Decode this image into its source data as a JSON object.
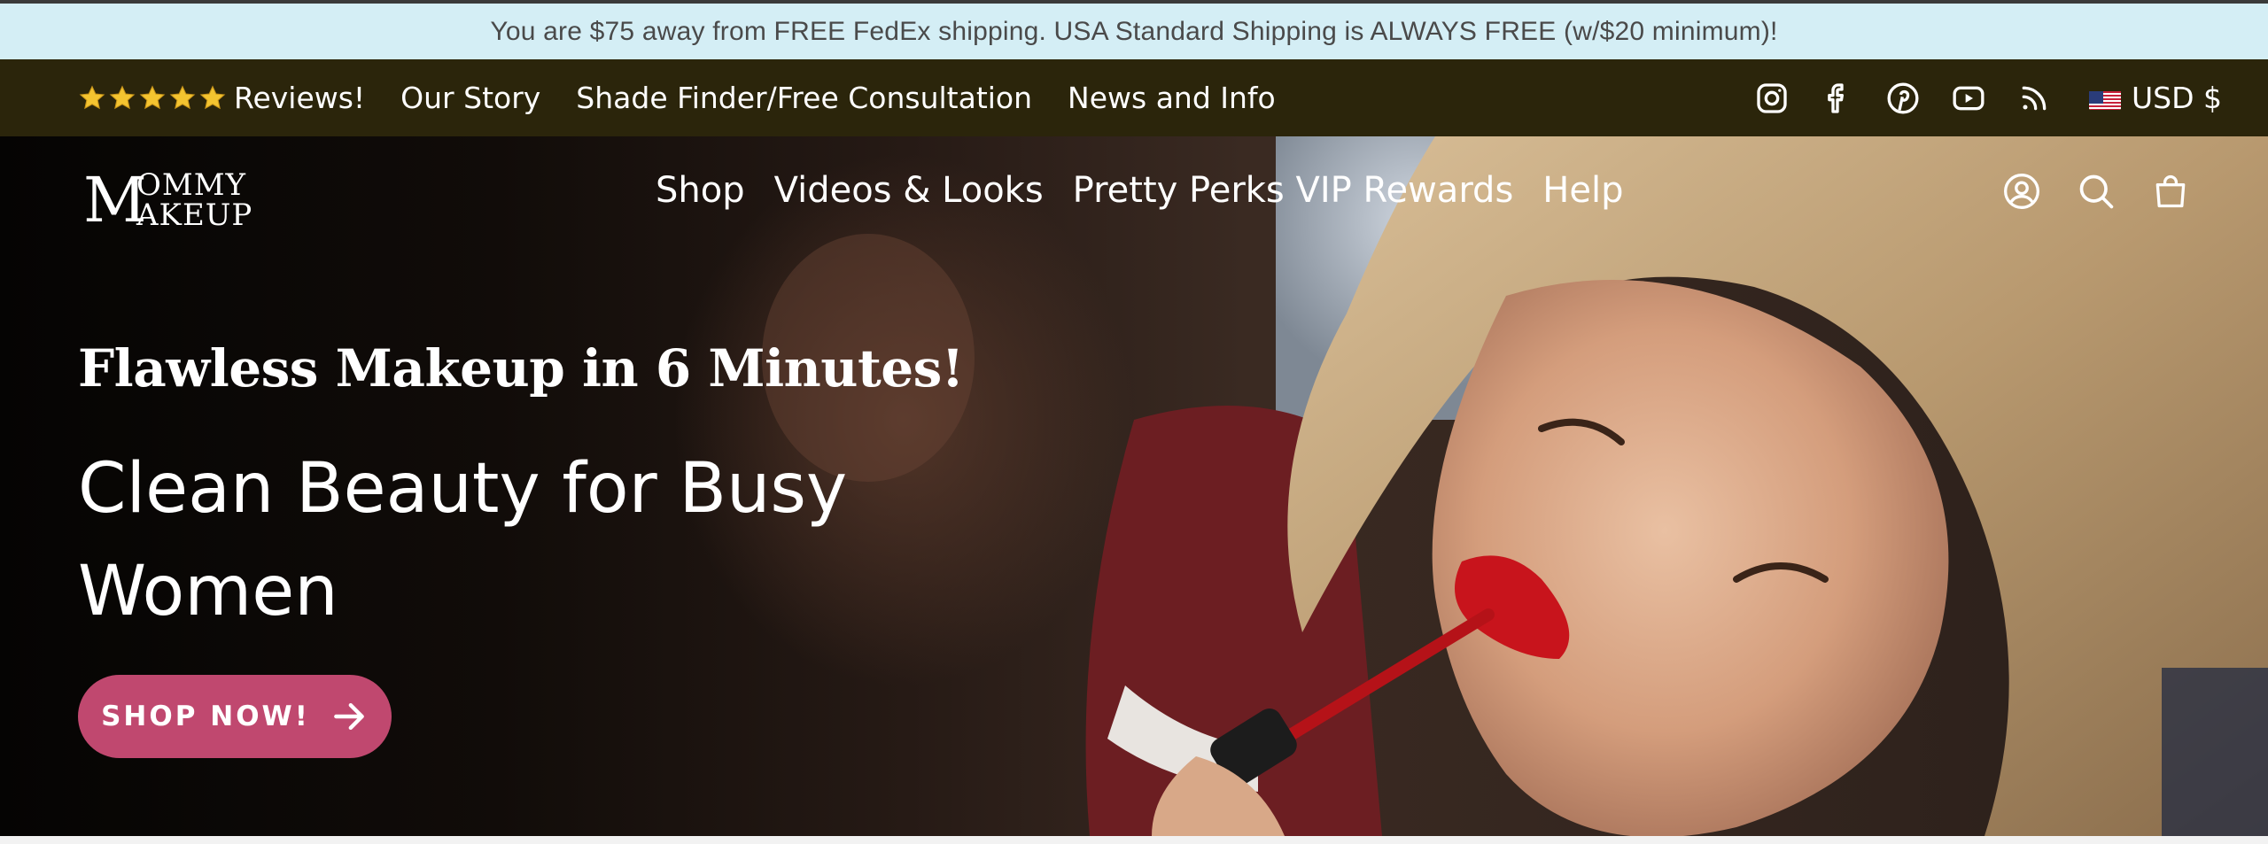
{
  "announcement": {
    "text": "You are $75 away from FREE FedEx shipping. USA Standard Shipping is ALWAYS FREE (w/$20 minimum)!"
  },
  "utility_bar": {
    "reviews": {
      "stars": 5,
      "label": "Reviews!"
    },
    "links": [
      "Our Story",
      "Shade Finder/Free Consultation",
      "News and Info"
    ],
    "social_icons": [
      "instagram-icon",
      "facebook-icon",
      "pinterest-icon",
      "youtube-icon",
      "rss-icon"
    ],
    "currency": {
      "flag": "us-flag-icon",
      "label": "USD $"
    }
  },
  "header": {
    "logo_text": "MOMMY MAKEUP",
    "nav": [
      "Shop",
      "Videos & Looks",
      "Pretty Perks VIP Rewards",
      "Help"
    ],
    "icons": [
      "account-icon",
      "search-icon",
      "cart-icon"
    ]
  },
  "hero": {
    "kicker": "Flawless Makeup in 6 Minutes!",
    "title": "Clean Beauty for Busy Women",
    "button_label": "SHOP NOW!",
    "button_icon": "arrow-right-icon"
  },
  "colors": {
    "announcement_bg": "#d4eef5",
    "utility_bg": "#2b250b",
    "button": "#c0486f",
    "star": "#f4c430"
  }
}
